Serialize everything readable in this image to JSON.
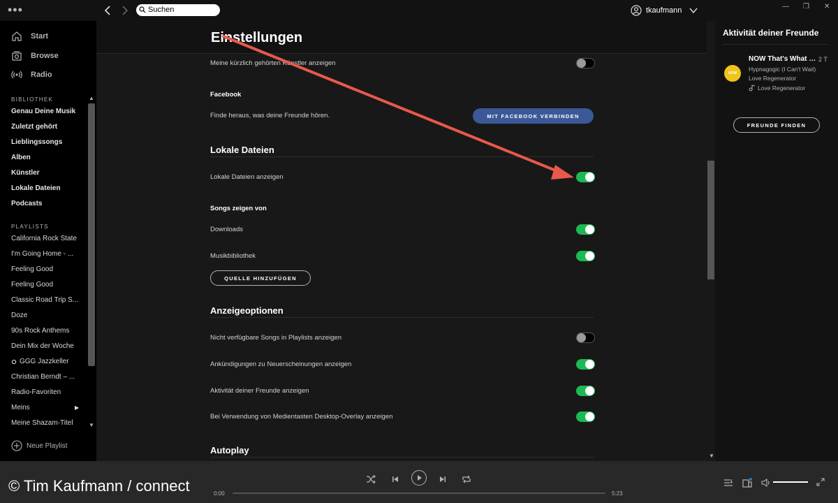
{
  "topbar": {
    "menu_dots": "•••",
    "search_placeholder": "Suchen",
    "username": "tkaufmann"
  },
  "sidebar": {
    "nav": [
      {
        "label": "Start",
        "icon": "home-icon"
      },
      {
        "label": "Browse",
        "icon": "browse-icon"
      },
      {
        "label": "Radio",
        "icon": "radio-icon"
      }
    ],
    "library_label": "BIBLIOTHEK",
    "library": [
      "Genau Deine Musik",
      "Zuletzt gehört",
      "Lieblingssongs",
      "Alben",
      "Künstler",
      "Lokale Dateien",
      "Podcasts"
    ],
    "playlists_label": "PLAYLISTS",
    "playlists": [
      "California Rock State",
      "I'm Going Home - ...",
      "Feeling Good",
      "Feeling Good",
      "Classic Road Trip S...",
      "Doze",
      "90s Rock Anthems",
      "Dein Mix der Woche",
      "GGG Jazzkeller",
      "Christian Berndt – ...",
      "Radio-Favoriten",
      "Meins",
      "Meine Shazam-Titel"
    ],
    "new_playlist": "Neue Playlist"
  },
  "settings": {
    "title": "Einstellungen",
    "recent_artists": {
      "label": "Meine kürzlich gehörten Künstler anzeigen",
      "enabled": false
    },
    "facebook": {
      "heading": "Facebook",
      "description": "Finde heraus, was deine Freunde hören.",
      "button": "MIT FACEBOOK VERBINDEN"
    },
    "local_files": {
      "heading": "Lokale Dateien",
      "show_label": "Lokale Dateien anzeigen",
      "show_enabled": true,
      "sources_heading": "Songs zeigen von",
      "sources": [
        {
          "label": "Downloads",
          "enabled": true
        },
        {
          "label": "Musikbibliothek",
          "enabled": true
        }
      ],
      "add_source_button": "QUELLE HINZUFÜGEN"
    },
    "display": {
      "heading": "Anzeigeoptionen",
      "options": [
        {
          "label": "Nicht verfügbare Songs in Playlists anzeigen",
          "enabled": false
        },
        {
          "label": "Ankündigungen zu Neuerscheinungen anzeigen",
          "enabled": true
        },
        {
          "label": "Aktivität deiner Freunde anzeigen",
          "enabled": true
        },
        {
          "label": "Bei Verwendung von Medientasten Desktop-Overlay anzeigen",
          "enabled": true
        }
      ]
    },
    "autoplay_heading": "Autoplay"
  },
  "friends": {
    "title": "Aktivität deiner Freunde",
    "activity": {
      "avatar_text": "NOW",
      "name": "NOW That's What I Call Music",
      "time": "2 T",
      "track": "Hypnagogic (I Can't Wait)",
      "artist": "Love Regenerator",
      "context": "Love Regenerator"
    },
    "find_button": "FREUNDE FINDEN"
  },
  "player": {
    "watermark": "© Tim Kaufmann / connect",
    "elapsed": "0:00",
    "duration": "5:23",
    "progress": 0,
    "volume": 1.0
  },
  "colors": {
    "accent_green": "#1db954",
    "facebook_blue": "#3b5998",
    "annotation_arrow": "#e8594a"
  }
}
